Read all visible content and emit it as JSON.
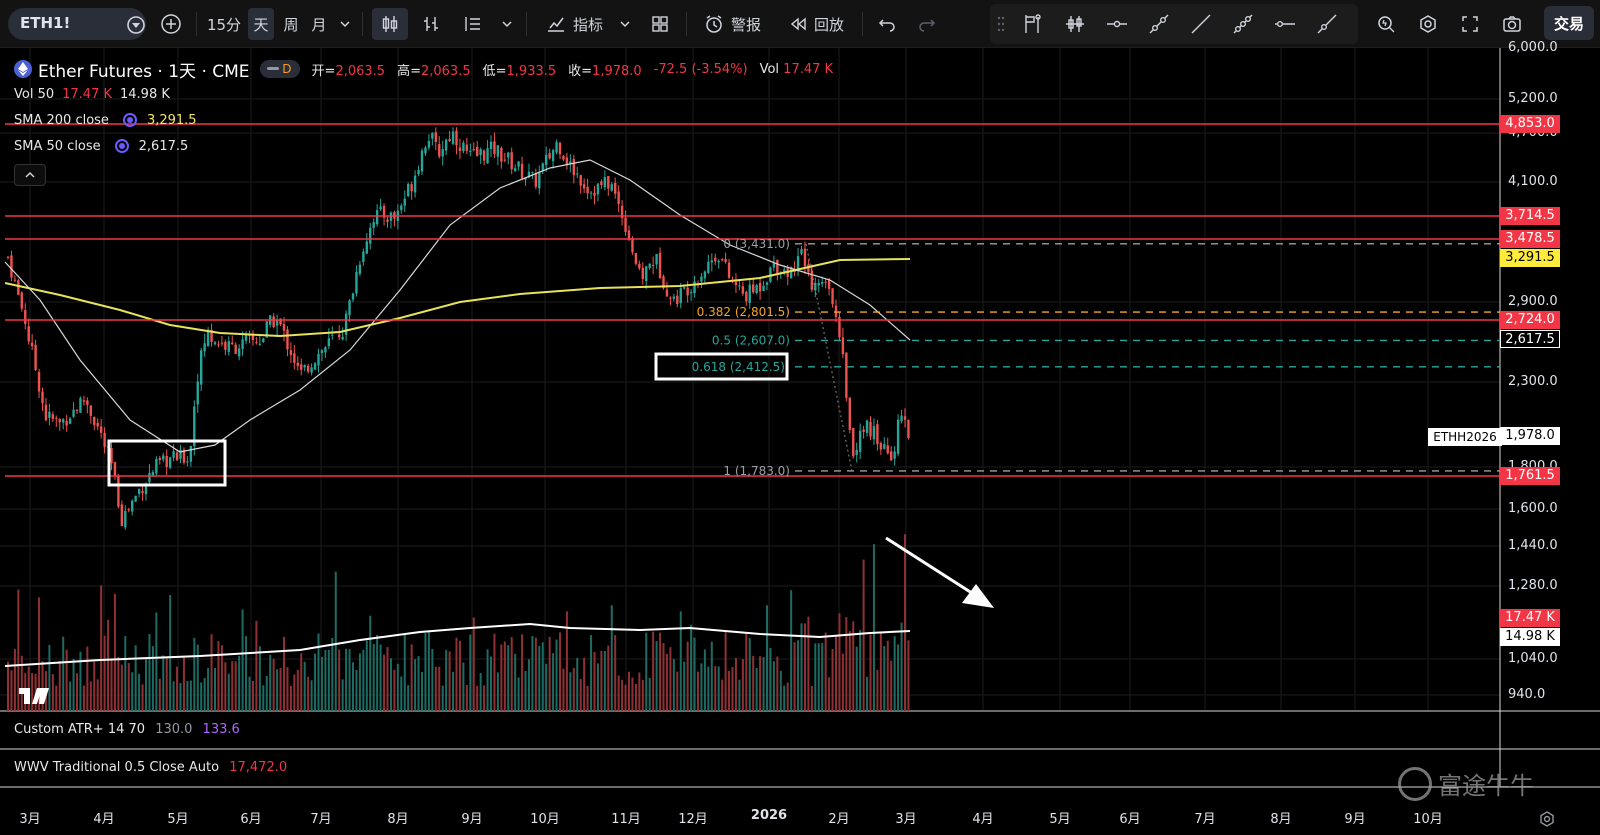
{
  "toolbar": {
    "symbol": "ETH1!",
    "timeframes": [
      {
        "label": "15分",
        "active": false
      },
      {
        "label": "天",
        "active": true
      },
      {
        "label": "周",
        "active": false
      },
      {
        "label": "月",
        "active": false
      }
    ],
    "indicators_label": "指标",
    "alert_label": "警报",
    "replay_label": "回放",
    "trade_label": "交易"
  },
  "legend": {
    "title": "Ether Futures · 1天 · CME",
    "badge": "D",
    "open_label": "开=",
    "open": "2,063.5",
    "high_label": "高=",
    "high": "2,063.5",
    "low_label": "低=",
    "low": "1,933.5",
    "close_label": "收=",
    "close": "1,978.0",
    "change": "-72.5 (-3.54%)",
    "vol_label": "Vol",
    "vol": "17.47 K",
    "vol50_name": "Vol 50",
    "vol50_a": "17.47 K",
    "vol50_b": "14.98 K",
    "sma200_name": "SMA 200 close",
    "sma200_val": "3,291.5",
    "sma50_name": "SMA 50 close",
    "sma50_val": "2,617.5"
  },
  "price_axis": [
    "6,000.0",
    "5,200.0",
    "4,700.0",
    "4,100.0",
    "2,900.0",
    "2,300.0",
    "1,800.0",
    "1,600.0",
    "1,440.0",
    "1,280.0",
    "1,040.0",
    "940.0"
  ],
  "price_tags": [
    {
      "label": "4,853.0",
      "style": "red"
    },
    {
      "label": "3,714.5",
      "style": "red"
    },
    {
      "label": "3,478.5",
      "style": "red"
    },
    {
      "label": "3,291.5",
      "style": "yellow"
    },
    {
      "label": "2,724.0",
      "style": "red"
    },
    {
      "label": "2,617.5",
      "style": "white-outline"
    },
    {
      "label": "1,978.0",
      "style": "white"
    },
    {
      "label": "1,761.5",
      "style": "red"
    },
    {
      "label": "17.47 K",
      "style": "red"
    },
    {
      "label": "14.98 K",
      "style": "white"
    }
  ],
  "contract_tag": "ETHH2026",
  "fib_levels": [
    {
      "label": "0 (3,431.0)",
      "color": "#9aa0a6"
    },
    {
      "label": "0.382 (2,801.5)",
      "color": "#f5a623"
    },
    {
      "label": "0.5 (2,607.0)",
      "color": "#26a69a"
    },
    {
      "label": "0.618 (2,412.5)",
      "color": "#26a69a"
    },
    {
      "label": "1 (1,783.0)",
      "color": "#9aa0a6"
    }
  ],
  "atr": {
    "name": "Custom ATR+ 14 70",
    "v1": "130.0",
    "v2": "133.6"
  },
  "wwv": {
    "name": "WWV Traditional 0.5 Close Auto",
    "value": "17,472.0"
  },
  "time_axis": [
    "3月",
    "4月",
    "5月",
    "6月",
    "7月",
    "8月",
    "9月",
    "10月",
    "11月",
    "12月",
    "2026",
    "2月",
    "3月",
    "4月",
    "5月",
    "6月",
    "7月",
    "8月",
    "9月",
    "10月"
  ],
  "watermark": "富途牛牛",
  "colors": {
    "up": "#26a69a",
    "down": "#ef5350",
    "sma200": "#e7e25a",
    "sma50": "#d8d8d8",
    "hline": "#f23645"
  }
}
